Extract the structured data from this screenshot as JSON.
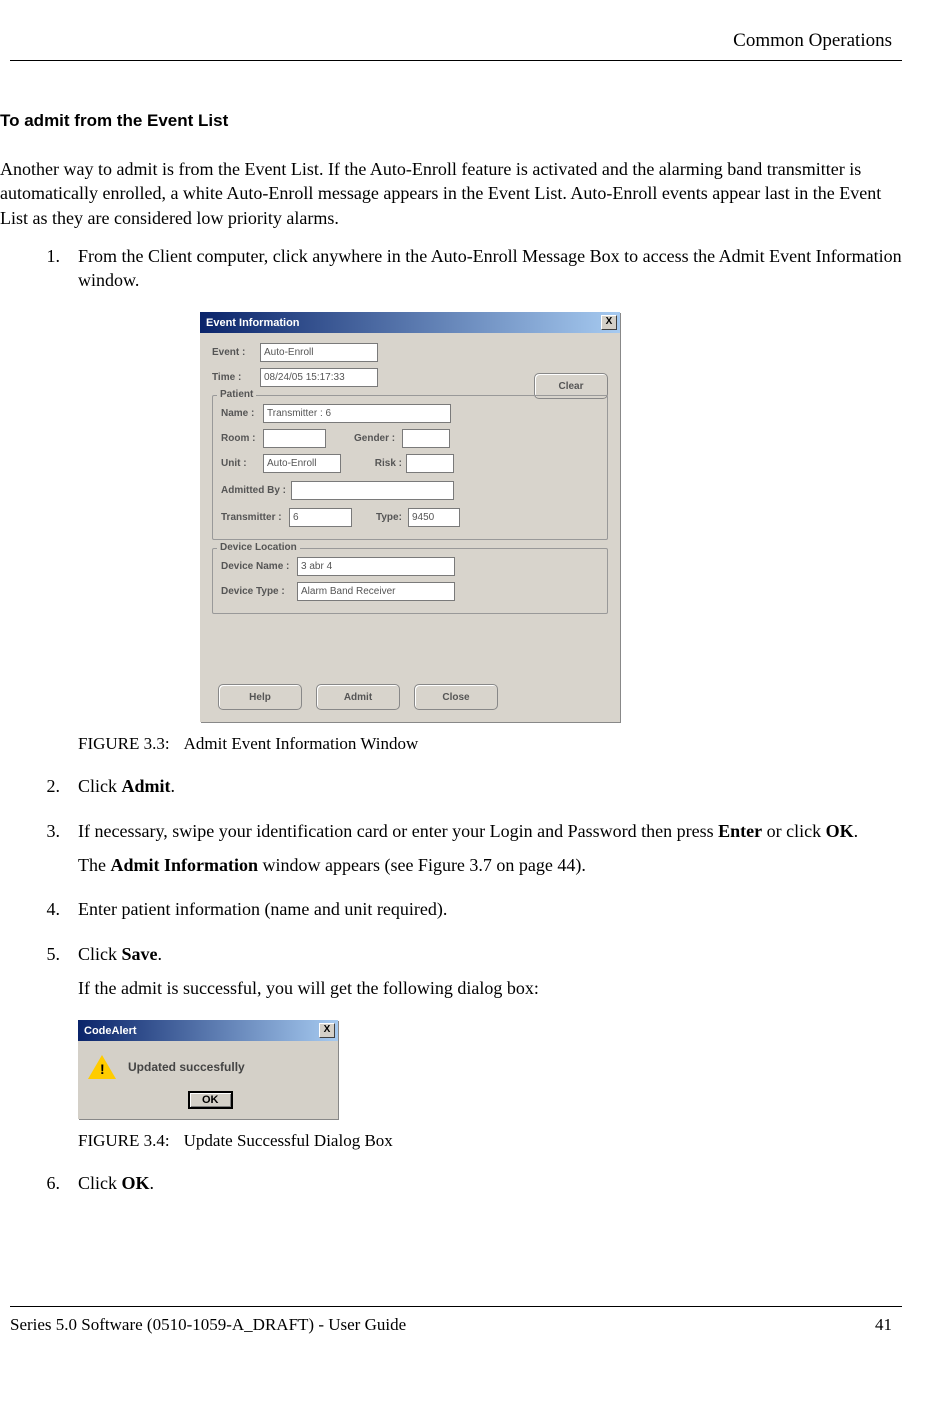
{
  "header": {
    "section": "Common Operations"
  },
  "heading": "To admit from the Event List",
  "intro": "Another way to admit is from the Event List. If the Auto-Enroll feature is activated and the alarming band transmitter is automatically enrolled, a white Auto-Enroll message appears in the Event List. Auto-Enroll events appear last in the Event List as they are considered low priority alarms.",
  "steps": {
    "s1_num": "1.",
    "s1": "From the Client computer, click anywhere in the Auto-Enroll Message Box to access the Admit Event Information window.",
    "s2_num": "2.",
    "s2_a": "Click ",
    "s2_b": "Admit",
    "s2_c": ".",
    "s3_num": "3.",
    "s3_a": "If necessary, swipe your identification card or enter your Login and Password then press ",
    "s3_b": "Enter",
    "s3_c": " or click ",
    "s3_d": "OK",
    "s3_e": ".",
    "s3_p2_a": "The ",
    "s3_p2_b": "Admit Information",
    "s3_p2_c": " window appears (see Figure 3.7 on page 44).",
    "s4_num": "4.",
    "s4": "Enter patient information (name and unit required).",
    "s5_num": "5.",
    "s5_a": "Click ",
    "s5_b": "Save",
    "s5_c": ".",
    "s5_p2": "If the admit is successful, you will get the following dialog box:",
    "s6_num": "6.",
    "s6_a": "Click ",
    "s6_b": "OK",
    "s6_c": "."
  },
  "fig33": {
    "label": "FIGURE 3.3:",
    "caption": "Admit Event Information Window"
  },
  "fig34": {
    "label": "FIGURE 3.4:",
    "caption": "Update Successful Dialog Box"
  },
  "dialog": {
    "title": "Event Information",
    "close_x": "X",
    "event_label": "Event :",
    "event_value": "Auto-Enroll",
    "time_label": "Time :",
    "time_value": "08/24/05 15:17:33",
    "clear": "Clear",
    "patient_section": "Patient",
    "name_label": "Name :",
    "name_value": "Transmitter : 6",
    "room_label": "Room :",
    "gender_label": "Gender :",
    "unit_label": "Unit :",
    "unit_value": "Auto-Enroll",
    "risk_label": "Risk :",
    "admitted_label": "Admitted By :",
    "tx_label": "Transmitter :",
    "tx_value": "6",
    "type_label": "Type:",
    "type_value": "9450",
    "devloc_section": "Device Location",
    "devname_label": "Device Name :",
    "devname_value": "3 abr 4",
    "devtype_label": "Device Type :",
    "devtype_value": "Alarm Band Receiver",
    "help": "Help",
    "admit": "Admit",
    "close": "Close"
  },
  "alert": {
    "title": "CodeAlert",
    "close_x": "X",
    "bang": "!",
    "msg": "Updated succesfully",
    "ok": "OK"
  },
  "footer": {
    "left": "Series 5.0 Software (0510-1059-A_DRAFT) - User Guide",
    "right": "41"
  }
}
